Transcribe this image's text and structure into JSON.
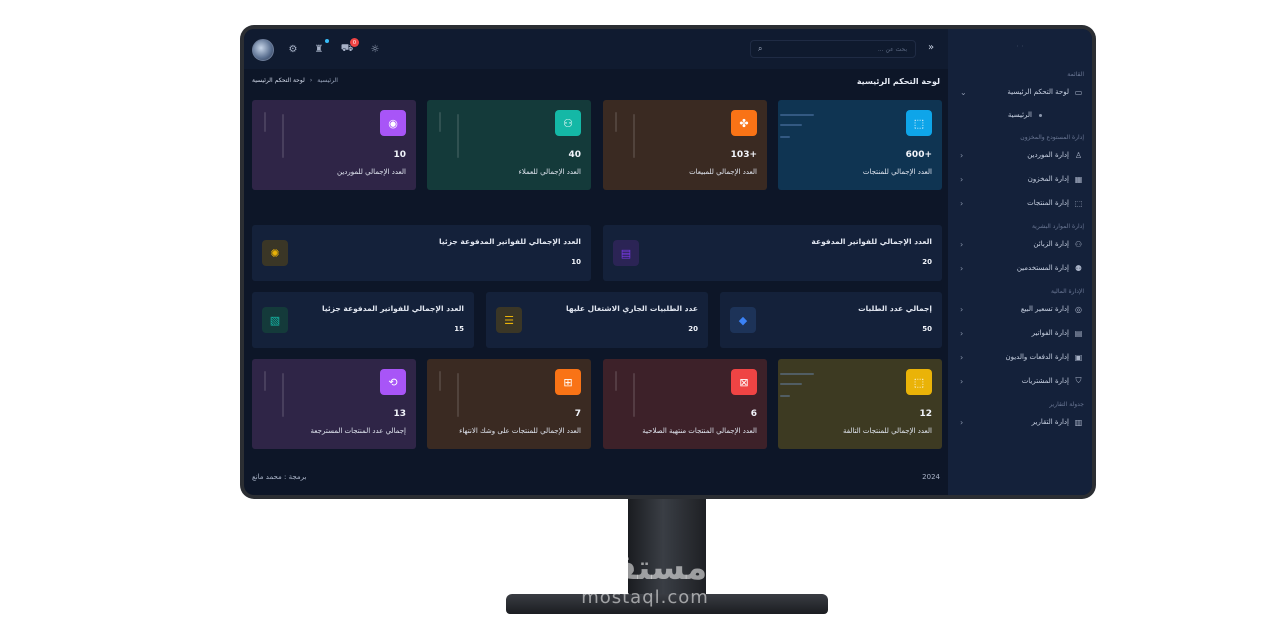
{
  "sidebar": {
    "logo": "· ·",
    "menu_heading": "القائمة",
    "dashboard": {
      "label": "لوحة التحكم الرئيسية",
      "icon": "monitor-icon"
    },
    "dashboard_sub": "الرئيسية",
    "groups": [
      {
        "heading": "إدارة المستودع والمخزون",
        "items": [
          {
            "label": "إدارة الموردين",
            "icon": "user-icon"
          },
          {
            "label": "إدارة المخزون",
            "icon": "warehouse-icon"
          },
          {
            "label": "إدارة المنتجات",
            "icon": "box-icon"
          }
        ]
      },
      {
        "heading": "إدارة الموارد البشرية",
        "items": [
          {
            "label": "إدارة الزبائن",
            "icon": "users-icon"
          },
          {
            "label": "إدارة المستخدمين",
            "icon": "user-cog-icon"
          }
        ]
      },
      {
        "heading": "الإدارة المالية",
        "items": [
          {
            "label": "إدارة تسعير البيع",
            "icon": "coin-icon"
          },
          {
            "label": "إدارة الفواتير",
            "icon": "invoice-icon"
          },
          {
            "label": "إدارة الدفعات والديون",
            "icon": "wallet-icon"
          },
          {
            "label": "إدارة المشتريات",
            "icon": "basket-icon"
          }
        ]
      },
      {
        "heading": "جدولة التقارير",
        "items": [
          {
            "label": "إدارة التقارير",
            "icon": "report-icon"
          }
        ]
      }
    ]
  },
  "topbar": {
    "search_placeholder": "بحث عن ...",
    "cart_badge": "0"
  },
  "main": {
    "page_title": "لوحة التحكم الرئيسية",
    "breadcrumb_home": "الرئيسية",
    "breadcrumb_current": "لوحة التحكم الرئيسية",
    "breadcrumb_sep": "‹"
  },
  "cards_row1": [
    {
      "value": "600+",
      "label": "العدد الإجمالي للمنتجات",
      "icon": "box-icon",
      "color": "#0ea5e9",
      "bg": "#0f3452"
    },
    {
      "value": "103+",
      "label": "العدد الإجمالي للمبيعات",
      "icon": "handshake-icon",
      "color": "#f97316",
      "bg": "#3a2a22"
    },
    {
      "value": "40",
      "label": "العدد الإجمالي للعملاء",
      "icon": "users-icon",
      "color": "#14b8a6",
      "bg": "#143a3a"
    },
    {
      "value": "10",
      "label": "العدد الإجمالي للموردين",
      "icon": "supplier-icon",
      "color": "#a855f7",
      "bg": "#2f2547"
    }
  ],
  "cards_row2": [
    {
      "value": "20",
      "label": "العدد الإجمالي للفواتير المدفوعة",
      "icon": "invoice-icon",
      "color": "#7c3aed",
      "iconbg": "#2b2455"
    },
    {
      "value": "10",
      "label": "العدد الإجمالي للفواتير المدفوعة جزئيا",
      "icon": "sun-icon",
      "color": "#eab308",
      "iconbg": "#3a3626"
    }
  ],
  "cards_row3": [
    {
      "value": "50",
      "label": "إجمالي عدد الطلبات",
      "icon": "cube-icon",
      "color": "#3b82f6",
      "iconbg": "#1d3358"
    },
    {
      "value": "20",
      "label": "عدد الطلبيات الجاري الاشتغال عليها",
      "icon": "list-icon",
      "color": "#eab308",
      "iconbg": "#3a3626"
    },
    {
      "value": "15",
      "label": "العدد الإجمالي للفواتير المدفوعة جزئيا",
      "icon": "clipboard-icon",
      "color": "#14b8a6",
      "iconbg": "#143a3a"
    }
  ],
  "cards_row4": [
    {
      "value": "12",
      "label": "العدد الإجمالي للمنتجات التالفة",
      "icon": "box-icon",
      "color": "#eab308",
      "bg": "#3d3a22"
    },
    {
      "value": "6",
      "label": "العدد الإجمالي المنتجات منتهية الصلاحية",
      "icon": "box-x-icon",
      "color": "#ef4444",
      "bg": "#3d2129"
    },
    {
      "value": "7",
      "label": "العدد الإجمالي للمنتجات على وشك الانتهاء",
      "icon": "boxes-icon",
      "color": "#f97316",
      "bg": "#3a2a22"
    },
    {
      "value": "13",
      "label": "إجمالي عدد المنتجات المسترجعة",
      "icon": "box-return-icon",
      "color": "#a855f7",
      "bg": "#2f2547"
    }
  ],
  "footer": {
    "credit": "برمجة : محمد مانع",
    "year": "2024"
  },
  "watermark": {
    "ar": "مستقل",
    "en": "mostaql.com"
  }
}
